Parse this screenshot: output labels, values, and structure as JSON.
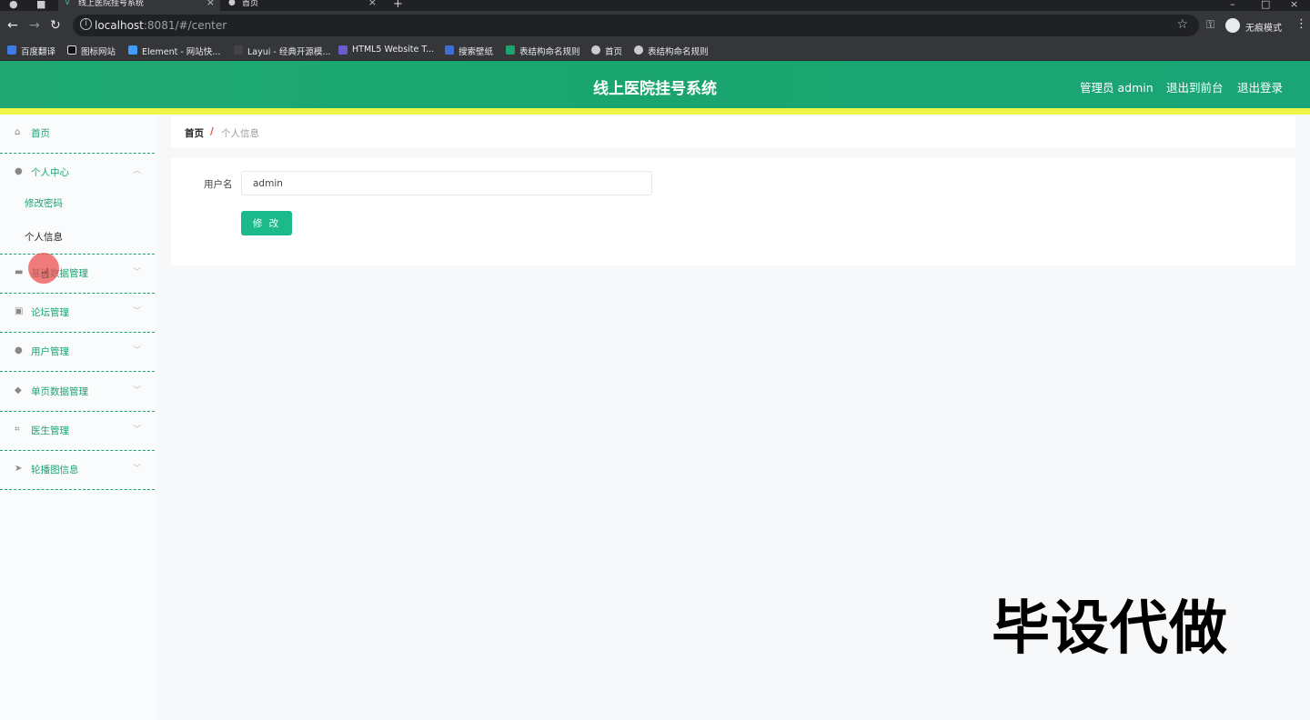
{
  "browser": {
    "tabs": [
      {
        "title": "线上医院挂号系统",
        "active": true
      },
      {
        "title": "首页",
        "active": false
      }
    ],
    "url_host": "localhost",
    "url_rest": ":8081/#/center",
    "incognito_label": "无痕模式",
    "bookmarks": [
      "百度翻译",
      "图标网站",
      "Element - 网站快...",
      "Layui - 经典开源模...",
      "HTML5 Website T...",
      "搜索壁纸",
      "表结构命名规则",
      "首页",
      "表结构命名规则"
    ]
  },
  "header": {
    "title": "线上医院挂号系统",
    "admin_label": "管理员 admin",
    "to_frontend": "退出到前台",
    "logout": "退出登录",
    "color": "#1aa56f"
  },
  "sidebar": {
    "home": "首页",
    "personal_center": "个人中心",
    "change_password": "修改密码",
    "personal_info": "个人信息",
    "items": [
      "基础数据管理",
      "论坛管理",
      "用户管理",
      "单页数据管理",
      "医生管理",
      "轮播图信息"
    ]
  },
  "breadcrumb": {
    "home": "首页",
    "separator": "/",
    "current": "个人信息"
  },
  "form": {
    "username_label": "用户名",
    "username_value": "admin",
    "submit_label": "修 改"
  },
  "watermark": "毕设代做"
}
